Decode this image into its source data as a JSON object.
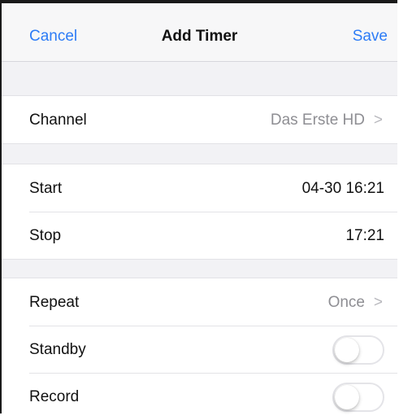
{
  "nav": {
    "cancel": "Cancel",
    "title": "Add Timer",
    "save": "Save"
  },
  "channel": {
    "label": "Channel",
    "value": "Das Erste HD",
    "chevron": ">"
  },
  "start": {
    "label": "Start",
    "value": "04-30 16:21"
  },
  "stop": {
    "label": "Stop",
    "value": "17:21"
  },
  "repeat": {
    "label": "Repeat",
    "value": "Once",
    "chevron": ">"
  },
  "standby": {
    "label": "Standby",
    "enabled": false
  },
  "record": {
    "label": "Record",
    "enabled": false
  },
  "colors": {
    "accent": "#2d7cf6",
    "background": "#f2f2f5"
  }
}
